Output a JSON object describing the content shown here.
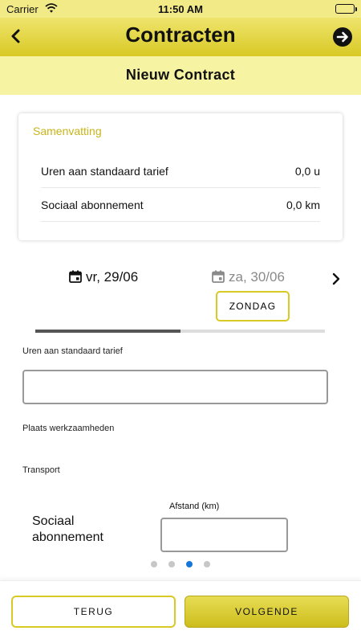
{
  "status_bar": {
    "carrier": "Carrier",
    "time": "11:50 AM",
    "wifi_icon": "wifi-icon",
    "battery_icon": "battery-icon"
  },
  "nav": {
    "title": "Contracten",
    "back_icon": "chevron-left-icon",
    "next_icon": "arrow-circle-right-icon"
  },
  "subheader": {
    "title": "Nieuw Contract"
  },
  "summary": {
    "heading": "Samenvatting",
    "rows": [
      {
        "label": "Uren aan standaard tarief",
        "value": "0,0 u"
      },
      {
        "label": "Sociaal abonnement",
        "value": "0,0 km"
      }
    ]
  },
  "day_selector": {
    "days": [
      {
        "label": "vr, 29/06",
        "active": true,
        "icon": "calendar-icon"
      },
      {
        "label": "za, 30/06",
        "active": false,
        "icon": "calendar-icon"
      }
    ],
    "badge": "ZONDAG",
    "next_icon": "chevron-right-icon",
    "progress": 0.5
  },
  "form": {
    "uren_label": "Uren aan standaard tarief",
    "uren_value": "",
    "plaats_label": "Plaats werkzaamheden",
    "transport_label": "Transport",
    "sociaal_label": "Sociaal abonnement",
    "afstand_label": "Afstand (km)",
    "afstand_value": ""
  },
  "pager": {
    "count": 4,
    "active_index": 2
  },
  "footer": {
    "back_label": "TERUG",
    "next_label": "VOLGENDE"
  },
  "colors": {
    "brand_yellow": "#d8c925",
    "subheader_bg": "#f6f3a3",
    "accent_text": "#c9b51a",
    "active_dot": "#1677d8"
  }
}
